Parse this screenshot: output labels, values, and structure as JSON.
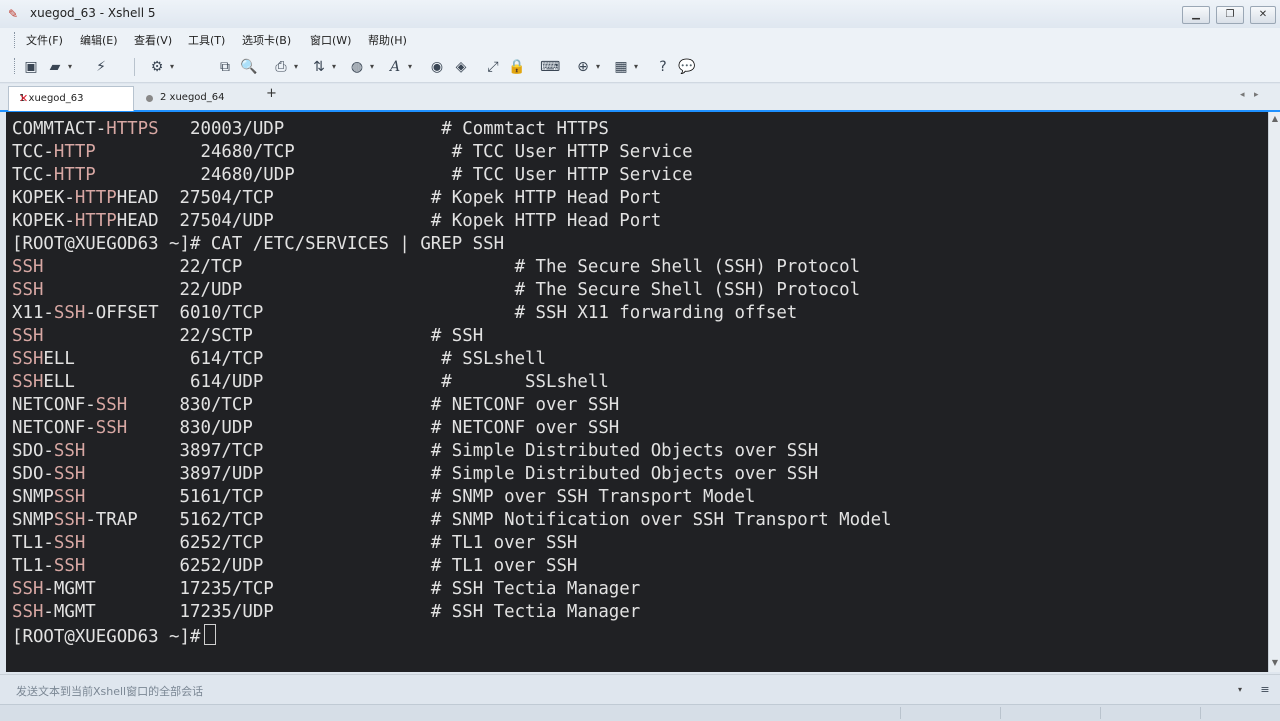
{
  "window": {
    "title": "xuegod_63 - Xshell 5",
    "min_icon": "minimize-icon",
    "max_icon": "restore-icon",
    "close_icon": "close-icon"
  },
  "menu": [
    "文件(F)",
    "编辑(E)",
    "查看(V)",
    "工具(T)",
    "选项卡(B)",
    "窗口(W)",
    "帮助(H)"
  ],
  "toolbar_icons": [
    "new-session-icon",
    "open-folder-icon",
    "disconnect-icon",
    "properties-icon",
    "copy-icon",
    "find-icon",
    "print-icon",
    "transfer-icon",
    "globe-icon",
    "font-icon",
    "script-icon",
    "xftp-icon",
    "fullscreen-icon",
    "lock-icon",
    "keyboard-icon",
    "add-icon",
    "layout-icon",
    "help-icon",
    "chat-icon"
  ],
  "tabs": [
    {
      "label": "1 xuegod_63",
      "active": true
    },
    {
      "label": "2 xuegod_64",
      "active": false
    }
  ],
  "terminal": {
    "lines": [
      [
        "comm tact-",
        "https",
        "   20003/udp               # Commtact HTTPS"
      ],
      [
        "tcc-",
        "http",
        "          24680/tcp               # TCC User HTTP Service"
      ],
      [
        "tcc-",
        "http",
        "          24680/udp               # TCC User HTTP Service"
      ],
      [
        "kopek-",
        "http",
        "head  27504/tcp               # Kopek HTTP Head Port"
      ],
      [
        "kopek-",
        "http",
        "head  27504/udp               # Kopek HTTP Head Port"
      ],
      [
        "[root@xuegod63 ~]# cat /etc/services | grep ssh",
        "",
        ""
      ],
      [
        "",
        "ssh",
        "             22/tcp                          # The Secure Shell (SSH) Protocol"
      ],
      [
        "",
        "ssh",
        "             22/udp                          # The Secure Shell (SSH) Protocol"
      ],
      [
        "x11-",
        "ssh",
        "-offset  6010/tcp                        # SSH X11 forwarding offset"
      ],
      [
        "",
        "ssh",
        "             22/sctp                 # SSH"
      ],
      [
        "",
        "ssh",
        "ell           614/tcp                 # SSLshell"
      ],
      [
        "",
        "ssh",
        "ell           614/udp                 #       SSLshell"
      ],
      [
        "netconf-",
        "ssh",
        "     830/tcp                 # NETCONF over SSH"
      ],
      [
        "netconf-",
        "ssh",
        "     830/udp                 # NETCONF over SSH"
      ],
      [
        "sdo-",
        "ssh",
        "         3897/tcp                # Simple Distributed Objects over SSH"
      ],
      [
        "sdo-",
        "ssh",
        "         3897/udp                # Simple Distributed Objects over SSH"
      ],
      [
        "snmp",
        "ssh",
        "         5161/tcp                # SNMP over SSH Transport Model"
      ],
      [
        "snmp",
        "ssh",
        "-trap    5162/tcp                # SNMP Notification over SSH Transport Model"
      ],
      [
        "tl1-",
        "ssh",
        "         6252/tcp                # TL1 over SSH"
      ],
      [
        "tl1-",
        "ssh",
        "         6252/udp                # TL1 over SSH"
      ],
      [
        "",
        "ssh",
        "-mgmt        17235/tcp               # SSH Tectia Manager"
      ],
      [
        "",
        "ssh",
        "-mgmt        17235/udp               # SSH Tectia Manager"
      ],
      [
        "[root@xuegod63 ~]#",
        "",
        ""
      ]
    ]
  },
  "compose": {
    "placeholder": "发送文本到当前Xshell窗口的全部会话"
  }
}
